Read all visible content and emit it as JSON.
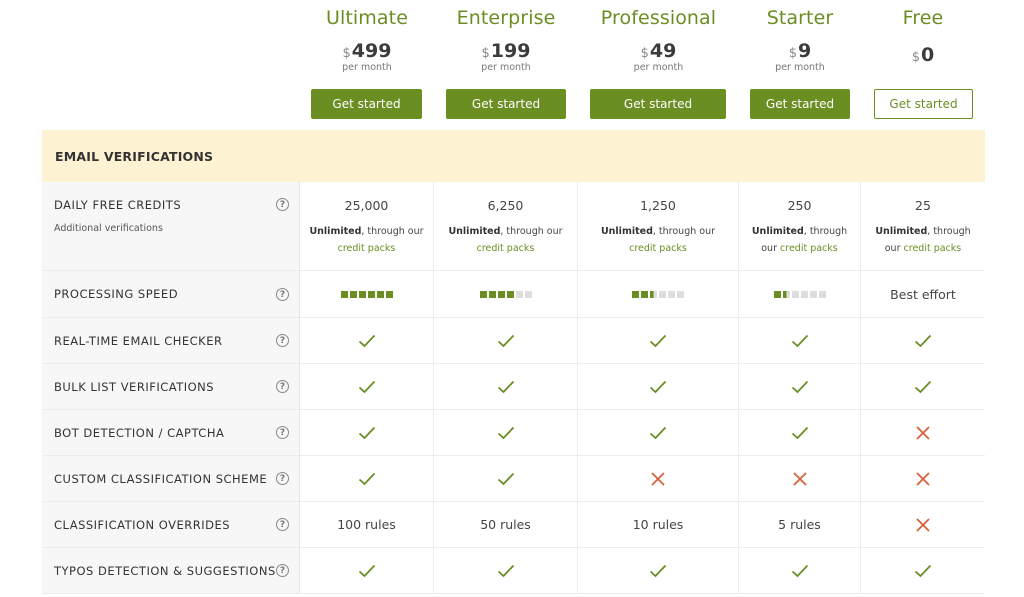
{
  "plans": [
    {
      "name": "Ultimate",
      "currency": "$",
      "price": "499",
      "period": "per month",
      "button": "Get started",
      "style": "solid"
    },
    {
      "name": "Enterprise",
      "currency": "$",
      "price": "199",
      "period": "per month",
      "button": "Get started",
      "style": "solid"
    },
    {
      "name": "Professional",
      "currency": "$",
      "price": "49",
      "period": "per month",
      "button": "Get started",
      "style": "solid"
    },
    {
      "name": "Starter",
      "currency": "$",
      "price": "9",
      "period": "per month",
      "button": "Get started",
      "style": "solid"
    },
    {
      "name": "Free",
      "currency": "$",
      "price": "0",
      "period": "",
      "button": "Get started",
      "style": "outline"
    }
  ],
  "section": {
    "title": "EMAIL VERIFICATIONS"
  },
  "rows": {
    "daily_credits": {
      "label": "DAILY FREE CREDITS",
      "sub": "Additional verifications",
      "values": [
        "25,000",
        "6,250",
        "1,250",
        "250",
        "25"
      ],
      "note_bold": "Unlimited",
      "note_text": ", through our",
      "note_link": "credit packs",
      "note_text_alt": ", through",
      "note_text_alt2": "our"
    },
    "processing_speed": {
      "label": "PROCESSING SPEED",
      "levels": [
        6,
        4,
        2.5,
        1.5,
        0
      ],
      "free_text": "Best effort"
    },
    "realtime": {
      "label": "REAL-TIME EMAIL CHECKER",
      "values": [
        "check",
        "check",
        "check",
        "check",
        "check"
      ]
    },
    "bulk": {
      "label": "BULK LIST VERIFICATIONS",
      "values": [
        "check",
        "check",
        "check",
        "check",
        "check"
      ]
    },
    "bot": {
      "label": "BOT DETECTION / CAPTCHA",
      "values": [
        "check",
        "check",
        "check",
        "check",
        "cross"
      ]
    },
    "custom": {
      "label": "CUSTOM CLASSIFICATION SCHEME",
      "values": [
        "check",
        "check",
        "cross",
        "cross",
        "cross"
      ]
    },
    "overrides": {
      "label": "CLASSIFICATION OVERRIDES",
      "values": [
        "100 rules",
        "50 rules",
        "10 rules",
        "5 rules",
        "cross"
      ]
    },
    "typos": {
      "label": "TYPOS DETECTION & SUGGESTIONS",
      "values": [
        "check",
        "check",
        "check",
        "check",
        "check"
      ]
    }
  },
  "icons": {
    "help": "?",
    "check_color": "#6b8e23",
    "cross_color": "#d9603b"
  },
  "colors": {
    "accent": "#6b8e23",
    "section_bg": "#fdf3d3"
  }
}
